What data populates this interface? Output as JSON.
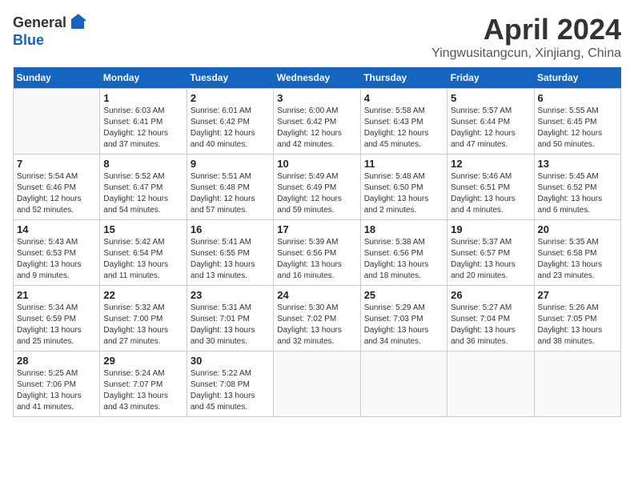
{
  "header": {
    "logo_general": "General",
    "logo_blue": "Blue",
    "month": "April 2024",
    "location": "Yingwusitangcun, Xinjiang, China"
  },
  "weekdays": [
    "Sunday",
    "Monday",
    "Tuesday",
    "Wednesday",
    "Thursday",
    "Friday",
    "Saturday"
  ],
  "weeks": [
    [
      {
        "day": "",
        "sunrise": "",
        "sunset": "",
        "daylight": ""
      },
      {
        "day": "1",
        "sunrise": "Sunrise: 6:03 AM",
        "sunset": "Sunset: 6:41 PM",
        "daylight": "Daylight: 12 hours and 37 minutes."
      },
      {
        "day": "2",
        "sunrise": "Sunrise: 6:01 AM",
        "sunset": "Sunset: 6:42 PM",
        "daylight": "Daylight: 12 hours and 40 minutes."
      },
      {
        "day": "3",
        "sunrise": "Sunrise: 6:00 AM",
        "sunset": "Sunset: 6:42 PM",
        "daylight": "Daylight: 12 hours and 42 minutes."
      },
      {
        "day": "4",
        "sunrise": "Sunrise: 5:58 AM",
        "sunset": "Sunset: 6:43 PM",
        "daylight": "Daylight: 12 hours and 45 minutes."
      },
      {
        "day": "5",
        "sunrise": "Sunrise: 5:57 AM",
        "sunset": "Sunset: 6:44 PM",
        "daylight": "Daylight: 12 hours and 47 minutes."
      },
      {
        "day": "6",
        "sunrise": "Sunrise: 5:55 AM",
        "sunset": "Sunset: 6:45 PM",
        "daylight": "Daylight: 12 hours and 50 minutes."
      }
    ],
    [
      {
        "day": "7",
        "sunrise": "Sunrise: 5:54 AM",
        "sunset": "Sunset: 6:46 PM",
        "daylight": "Daylight: 12 hours and 52 minutes."
      },
      {
        "day": "8",
        "sunrise": "Sunrise: 5:52 AM",
        "sunset": "Sunset: 6:47 PM",
        "daylight": "Daylight: 12 hours and 54 minutes."
      },
      {
        "day": "9",
        "sunrise": "Sunrise: 5:51 AM",
        "sunset": "Sunset: 6:48 PM",
        "daylight": "Daylight: 12 hours and 57 minutes."
      },
      {
        "day": "10",
        "sunrise": "Sunrise: 5:49 AM",
        "sunset": "Sunset: 6:49 PM",
        "daylight": "Daylight: 12 hours and 59 minutes."
      },
      {
        "day": "11",
        "sunrise": "Sunrise: 5:48 AM",
        "sunset": "Sunset: 6:50 PM",
        "daylight": "Daylight: 13 hours and 2 minutes."
      },
      {
        "day": "12",
        "sunrise": "Sunrise: 5:46 AM",
        "sunset": "Sunset: 6:51 PM",
        "daylight": "Daylight: 13 hours and 4 minutes."
      },
      {
        "day": "13",
        "sunrise": "Sunrise: 5:45 AM",
        "sunset": "Sunset: 6:52 PM",
        "daylight": "Daylight: 13 hours and 6 minutes."
      }
    ],
    [
      {
        "day": "14",
        "sunrise": "Sunrise: 5:43 AM",
        "sunset": "Sunset: 6:53 PM",
        "daylight": "Daylight: 13 hours and 9 minutes."
      },
      {
        "day": "15",
        "sunrise": "Sunrise: 5:42 AM",
        "sunset": "Sunset: 6:54 PM",
        "daylight": "Daylight: 13 hours and 11 minutes."
      },
      {
        "day": "16",
        "sunrise": "Sunrise: 5:41 AM",
        "sunset": "Sunset: 6:55 PM",
        "daylight": "Daylight: 13 hours and 13 minutes."
      },
      {
        "day": "17",
        "sunrise": "Sunrise: 5:39 AM",
        "sunset": "Sunset: 6:56 PM",
        "daylight": "Daylight: 13 hours and 16 minutes."
      },
      {
        "day": "18",
        "sunrise": "Sunrise: 5:38 AM",
        "sunset": "Sunset: 6:56 PM",
        "daylight": "Daylight: 13 hours and 18 minutes."
      },
      {
        "day": "19",
        "sunrise": "Sunrise: 5:37 AM",
        "sunset": "Sunset: 6:57 PM",
        "daylight": "Daylight: 13 hours and 20 minutes."
      },
      {
        "day": "20",
        "sunrise": "Sunrise: 5:35 AM",
        "sunset": "Sunset: 6:58 PM",
        "daylight": "Daylight: 13 hours and 23 minutes."
      }
    ],
    [
      {
        "day": "21",
        "sunrise": "Sunrise: 5:34 AM",
        "sunset": "Sunset: 6:59 PM",
        "daylight": "Daylight: 13 hours and 25 minutes."
      },
      {
        "day": "22",
        "sunrise": "Sunrise: 5:32 AM",
        "sunset": "Sunset: 7:00 PM",
        "daylight": "Daylight: 13 hours and 27 minutes."
      },
      {
        "day": "23",
        "sunrise": "Sunrise: 5:31 AM",
        "sunset": "Sunset: 7:01 PM",
        "daylight": "Daylight: 13 hours and 30 minutes."
      },
      {
        "day": "24",
        "sunrise": "Sunrise: 5:30 AM",
        "sunset": "Sunset: 7:02 PM",
        "daylight": "Daylight: 13 hours and 32 minutes."
      },
      {
        "day": "25",
        "sunrise": "Sunrise: 5:29 AM",
        "sunset": "Sunset: 7:03 PM",
        "daylight": "Daylight: 13 hours and 34 minutes."
      },
      {
        "day": "26",
        "sunrise": "Sunrise: 5:27 AM",
        "sunset": "Sunset: 7:04 PM",
        "daylight": "Daylight: 13 hours and 36 minutes."
      },
      {
        "day": "27",
        "sunrise": "Sunrise: 5:26 AM",
        "sunset": "Sunset: 7:05 PM",
        "daylight": "Daylight: 13 hours and 38 minutes."
      }
    ],
    [
      {
        "day": "28",
        "sunrise": "Sunrise: 5:25 AM",
        "sunset": "Sunset: 7:06 PM",
        "daylight": "Daylight: 13 hours and 41 minutes."
      },
      {
        "day": "29",
        "sunrise": "Sunrise: 5:24 AM",
        "sunset": "Sunset: 7:07 PM",
        "daylight": "Daylight: 13 hours and 43 minutes."
      },
      {
        "day": "30",
        "sunrise": "Sunrise: 5:22 AM",
        "sunset": "Sunset: 7:08 PM",
        "daylight": "Daylight: 13 hours and 45 minutes."
      },
      {
        "day": "",
        "sunrise": "",
        "sunset": "",
        "daylight": ""
      },
      {
        "day": "",
        "sunrise": "",
        "sunset": "",
        "daylight": ""
      },
      {
        "day": "",
        "sunrise": "",
        "sunset": "",
        "daylight": ""
      },
      {
        "day": "",
        "sunrise": "",
        "sunset": "",
        "daylight": ""
      }
    ]
  ]
}
